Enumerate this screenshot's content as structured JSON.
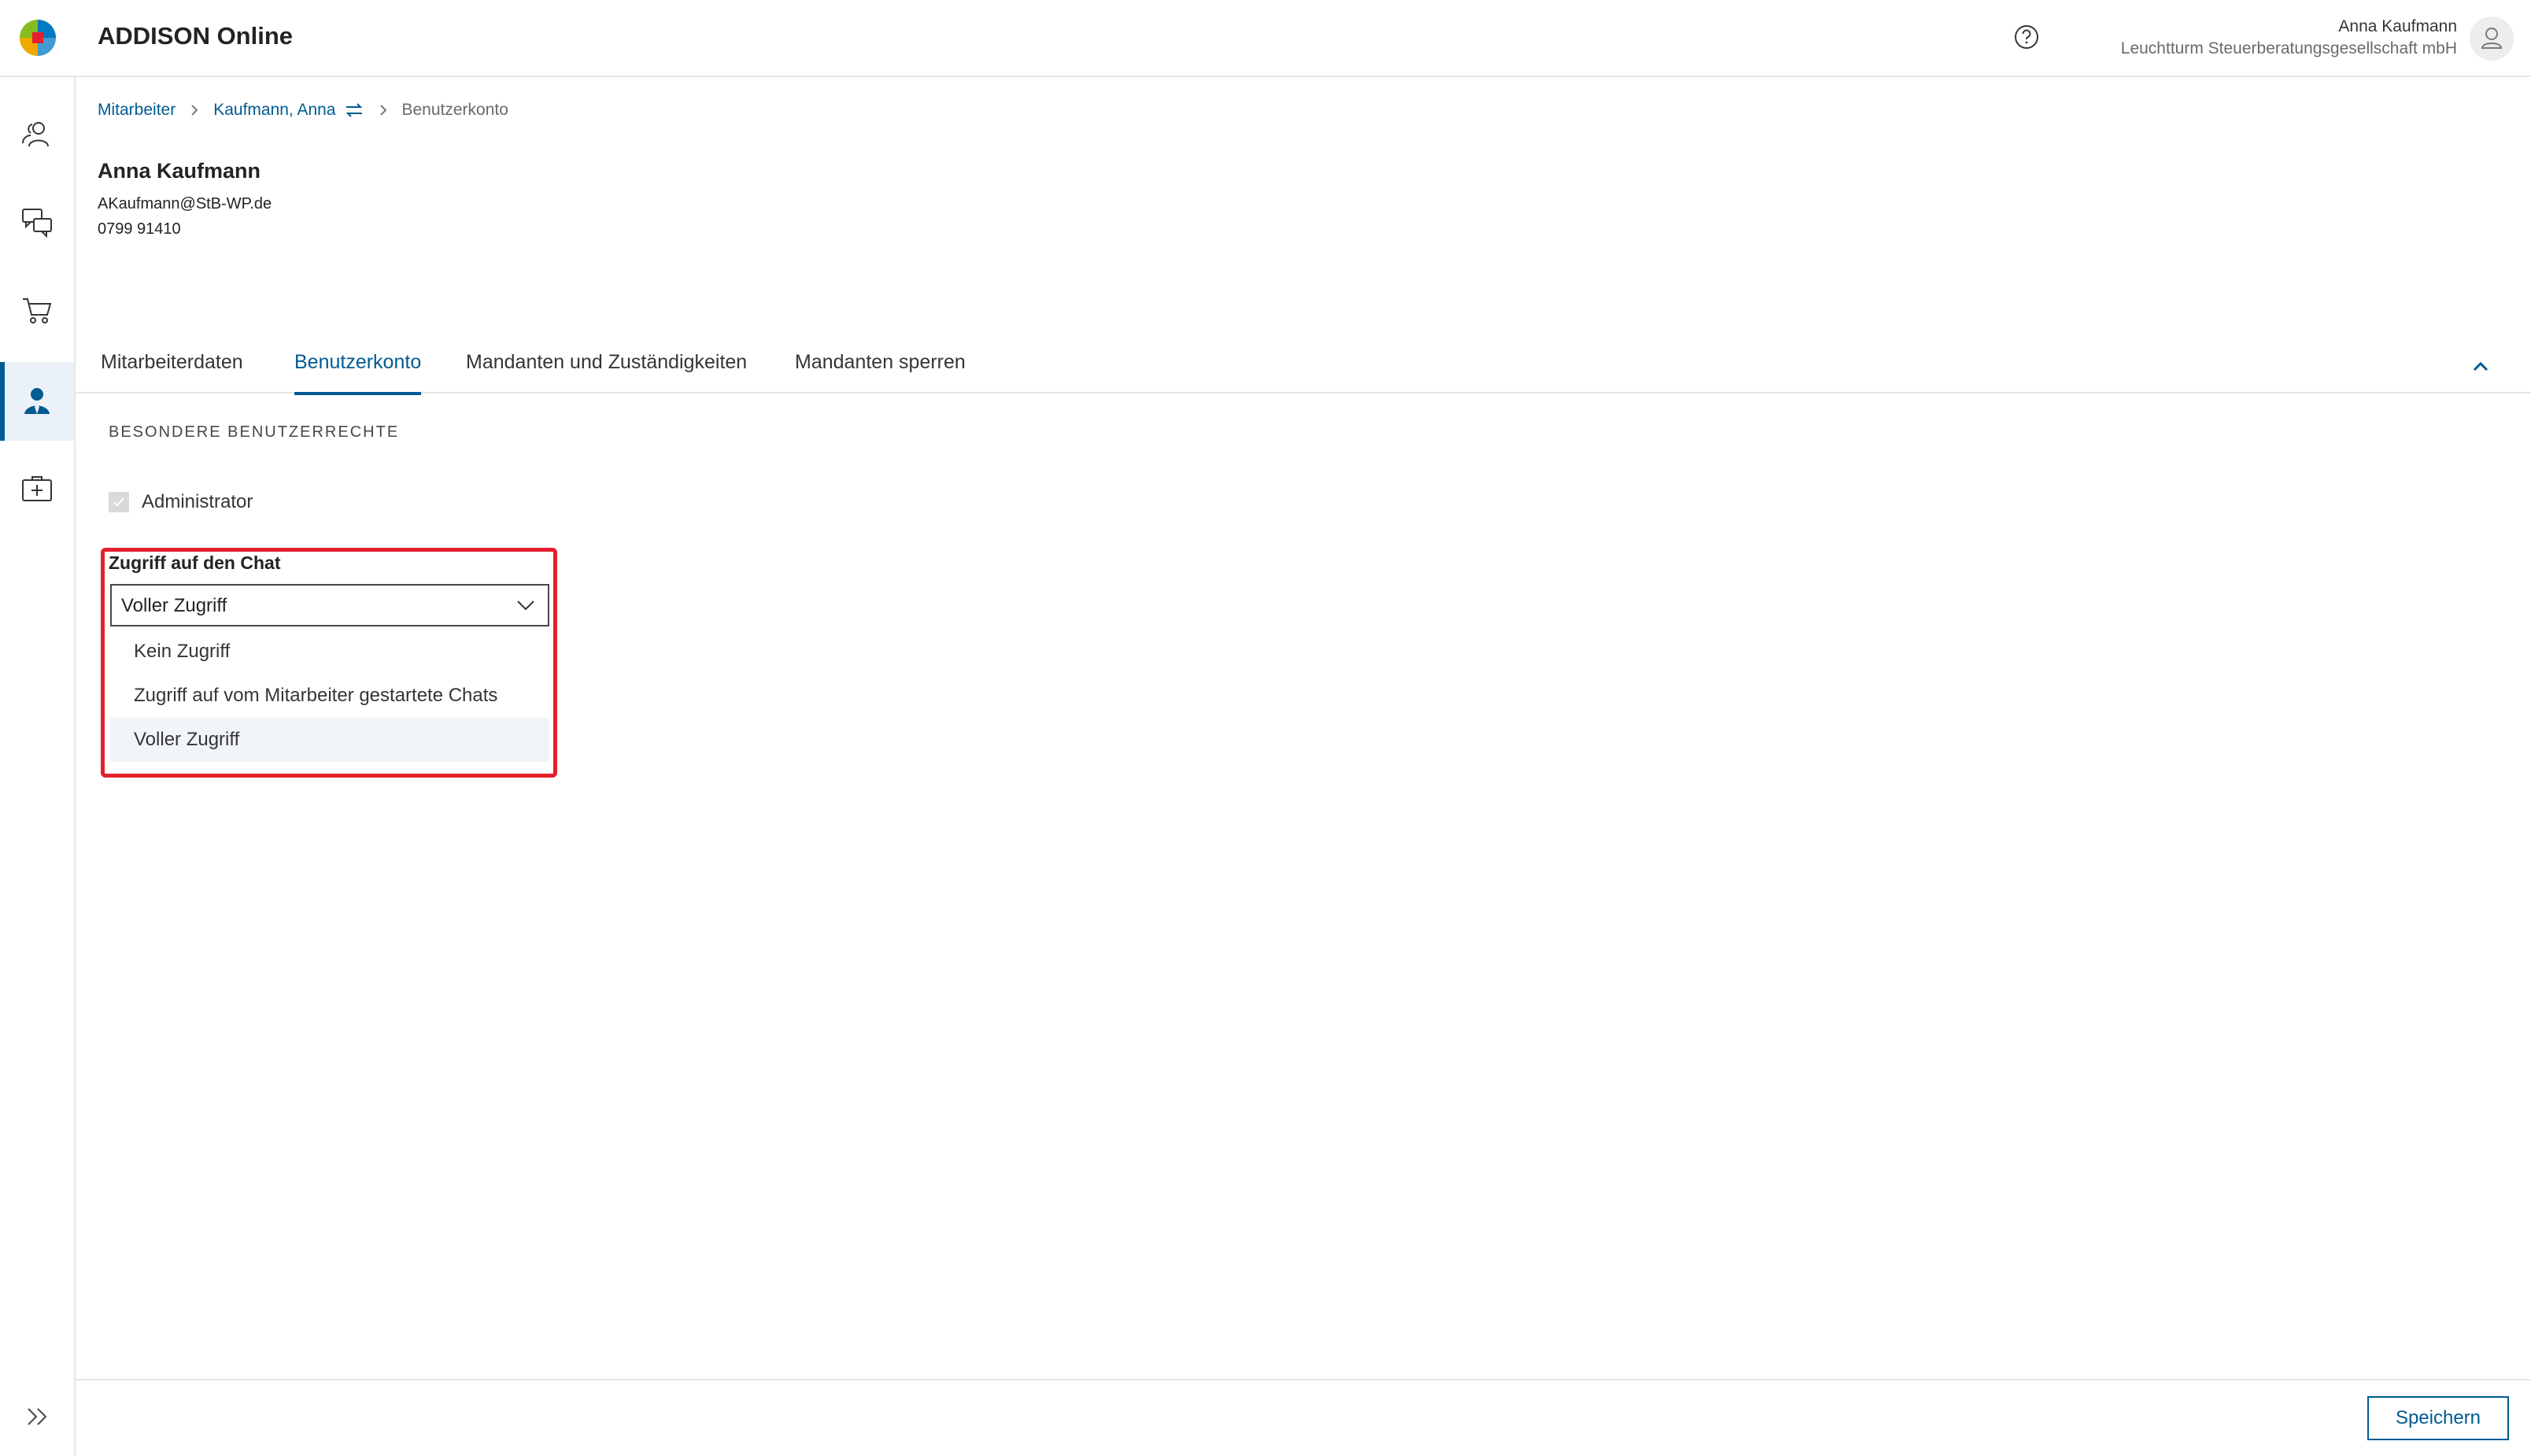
{
  "header": {
    "app_title": "ADDISON Online",
    "user_name": "Anna Kaufmann",
    "user_company": "Leuchtturm Steuerberatungsgesellschaft mbH"
  },
  "sidebar": {
    "items": [
      {
        "icon": "people-icon"
      },
      {
        "icon": "chat-icon"
      },
      {
        "icon": "cart-icon"
      },
      {
        "icon": "user-icon",
        "active": true
      },
      {
        "icon": "medical-case-icon"
      }
    ],
    "expand_icon": "double-chevron-right-icon"
  },
  "breadcrumb": {
    "items": [
      "Mitarbeiter",
      "Kaufmann, Anna",
      "Benutzerkonto"
    ]
  },
  "employee": {
    "name": "Anna Kaufmann",
    "email": "AKaufmann@StB-WP.de",
    "phone": "0799 91410"
  },
  "tabs": [
    {
      "label": "Mitarbeiterdaten"
    },
    {
      "label": "Benutzerkonto",
      "active": true
    },
    {
      "label": "Mandanten und Zuständigkeiten"
    },
    {
      "label": "Mandanten sperren"
    }
  ],
  "section": {
    "title": "BESONDERE BENUTZERRECHTE",
    "admin_label": "Administrator",
    "admin_checked": true
  },
  "chat_access": {
    "label": "Zugriff auf den Chat",
    "selected": "Voller Zugriff",
    "options": [
      "Kein Zugriff",
      "Zugriff auf vom Mitarbeiter gestartete Chats",
      "Voller Zugriff"
    ]
  },
  "footer": {
    "save_label": "Speichern"
  },
  "colors": {
    "accent": "#005b92",
    "highlight": "#e5202e"
  }
}
